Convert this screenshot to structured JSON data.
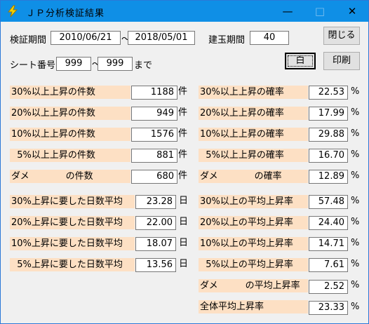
{
  "window": {
    "title": "ＪＰ分析検証結果",
    "minimize": "—",
    "maximize": "□",
    "close": "✕"
  },
  "period": {
    "label": "検証期間",
    "start": "2010/06/21",
    "separator": "〜",
    "end": "2018/05/01"
  },
  "position_period": {
    "label": "建玉期間",
    "value": "40"
  },
  "buttons": {
    "close_label": "閉じる",
    "white_label": "白",
    "print_label": "印刷"
  },
  "sheet": {
    "label": "シート番号",
    "from": "999",
    "separator": "〜",
    "to": "999",
    "suffix": "まで"
  },
  "counts": [
    {
      "label": "30%以上上昇の件数",
      "value": "1188",
      "unit": "件"
    },
    {
      "label": "20%以上上昇の件数",
      "value": "949",
      "unit": "件"
    },
    {
      "label": "10%以上上昇の件数",
      "value": "1576",
      "unit": "件"
    },
    {
      "label": "  5%以上上昇の件数",
      "value": "881",
      "unit": "件"
    },
    {
      "label": "ダメ　　　　の件数",
      "value": "680",
      "unit": "件"
    }
  ],
  "rates": [
    {
      "label": "30%以上上昇の確率",
      "value": "22.53",
      "unit": "%"
    },
    {
      "label": "20%以上上昇の確率",
      "value": "17.99",
      "unit": "%"
    },
    {
      "label": "10%以上上昇の確率",
      "value": "29.88",
      "unit": "%"
    },
    {
      "label": "  5%以上上昇の確率",
      "value": "16.70",
      "unit": "%"
    },
    {
      "label": "ダメ　　　　の確率",
      "value": "12.89",
      "unit": "%"
    }
  ],
  "days": [
    {
      "label": "30%上昇に要した日数平均",
      "value": "23.28",
      "unit": "日"
    },
    {
      "label": "20%上昇に要した日数平均",
      "value": "22.00",
      "unit": "日"
    },
    {
      "label": "10%上昇に要した日数平均",
      "value": "18.07",
      "unit": "日"
    },
    {
      "label": "  5%上昇に要した日数平均",
      "value": "13.56",
      "unit": "日"
    }
  ],
  "averages": [
    {
      "label": "30%以上の平均上昇率",
      "value": "57.48",
      "unit": "%"
    },
    {
      "label": "20%以上の平均上昇率",
      "value": "24.40",
      "unit": "%"
    },
    {
      "label": "10%以上の平均上昇率",
      "value": "14.71",
      "unit": "%"
    },
    {
      "label": "  5%以上の平均上昇率",
      "value": "7.61",
      "unit": "%"
    },
    {
      "label": "ダメ　　　の平均上昇率",
      "value": "2.52",
      "unit": "%"
    },
    {
      "label": "全体平均上昇率",
      "value": "23.33",
      "unit": "%"
    }
  ]
}
